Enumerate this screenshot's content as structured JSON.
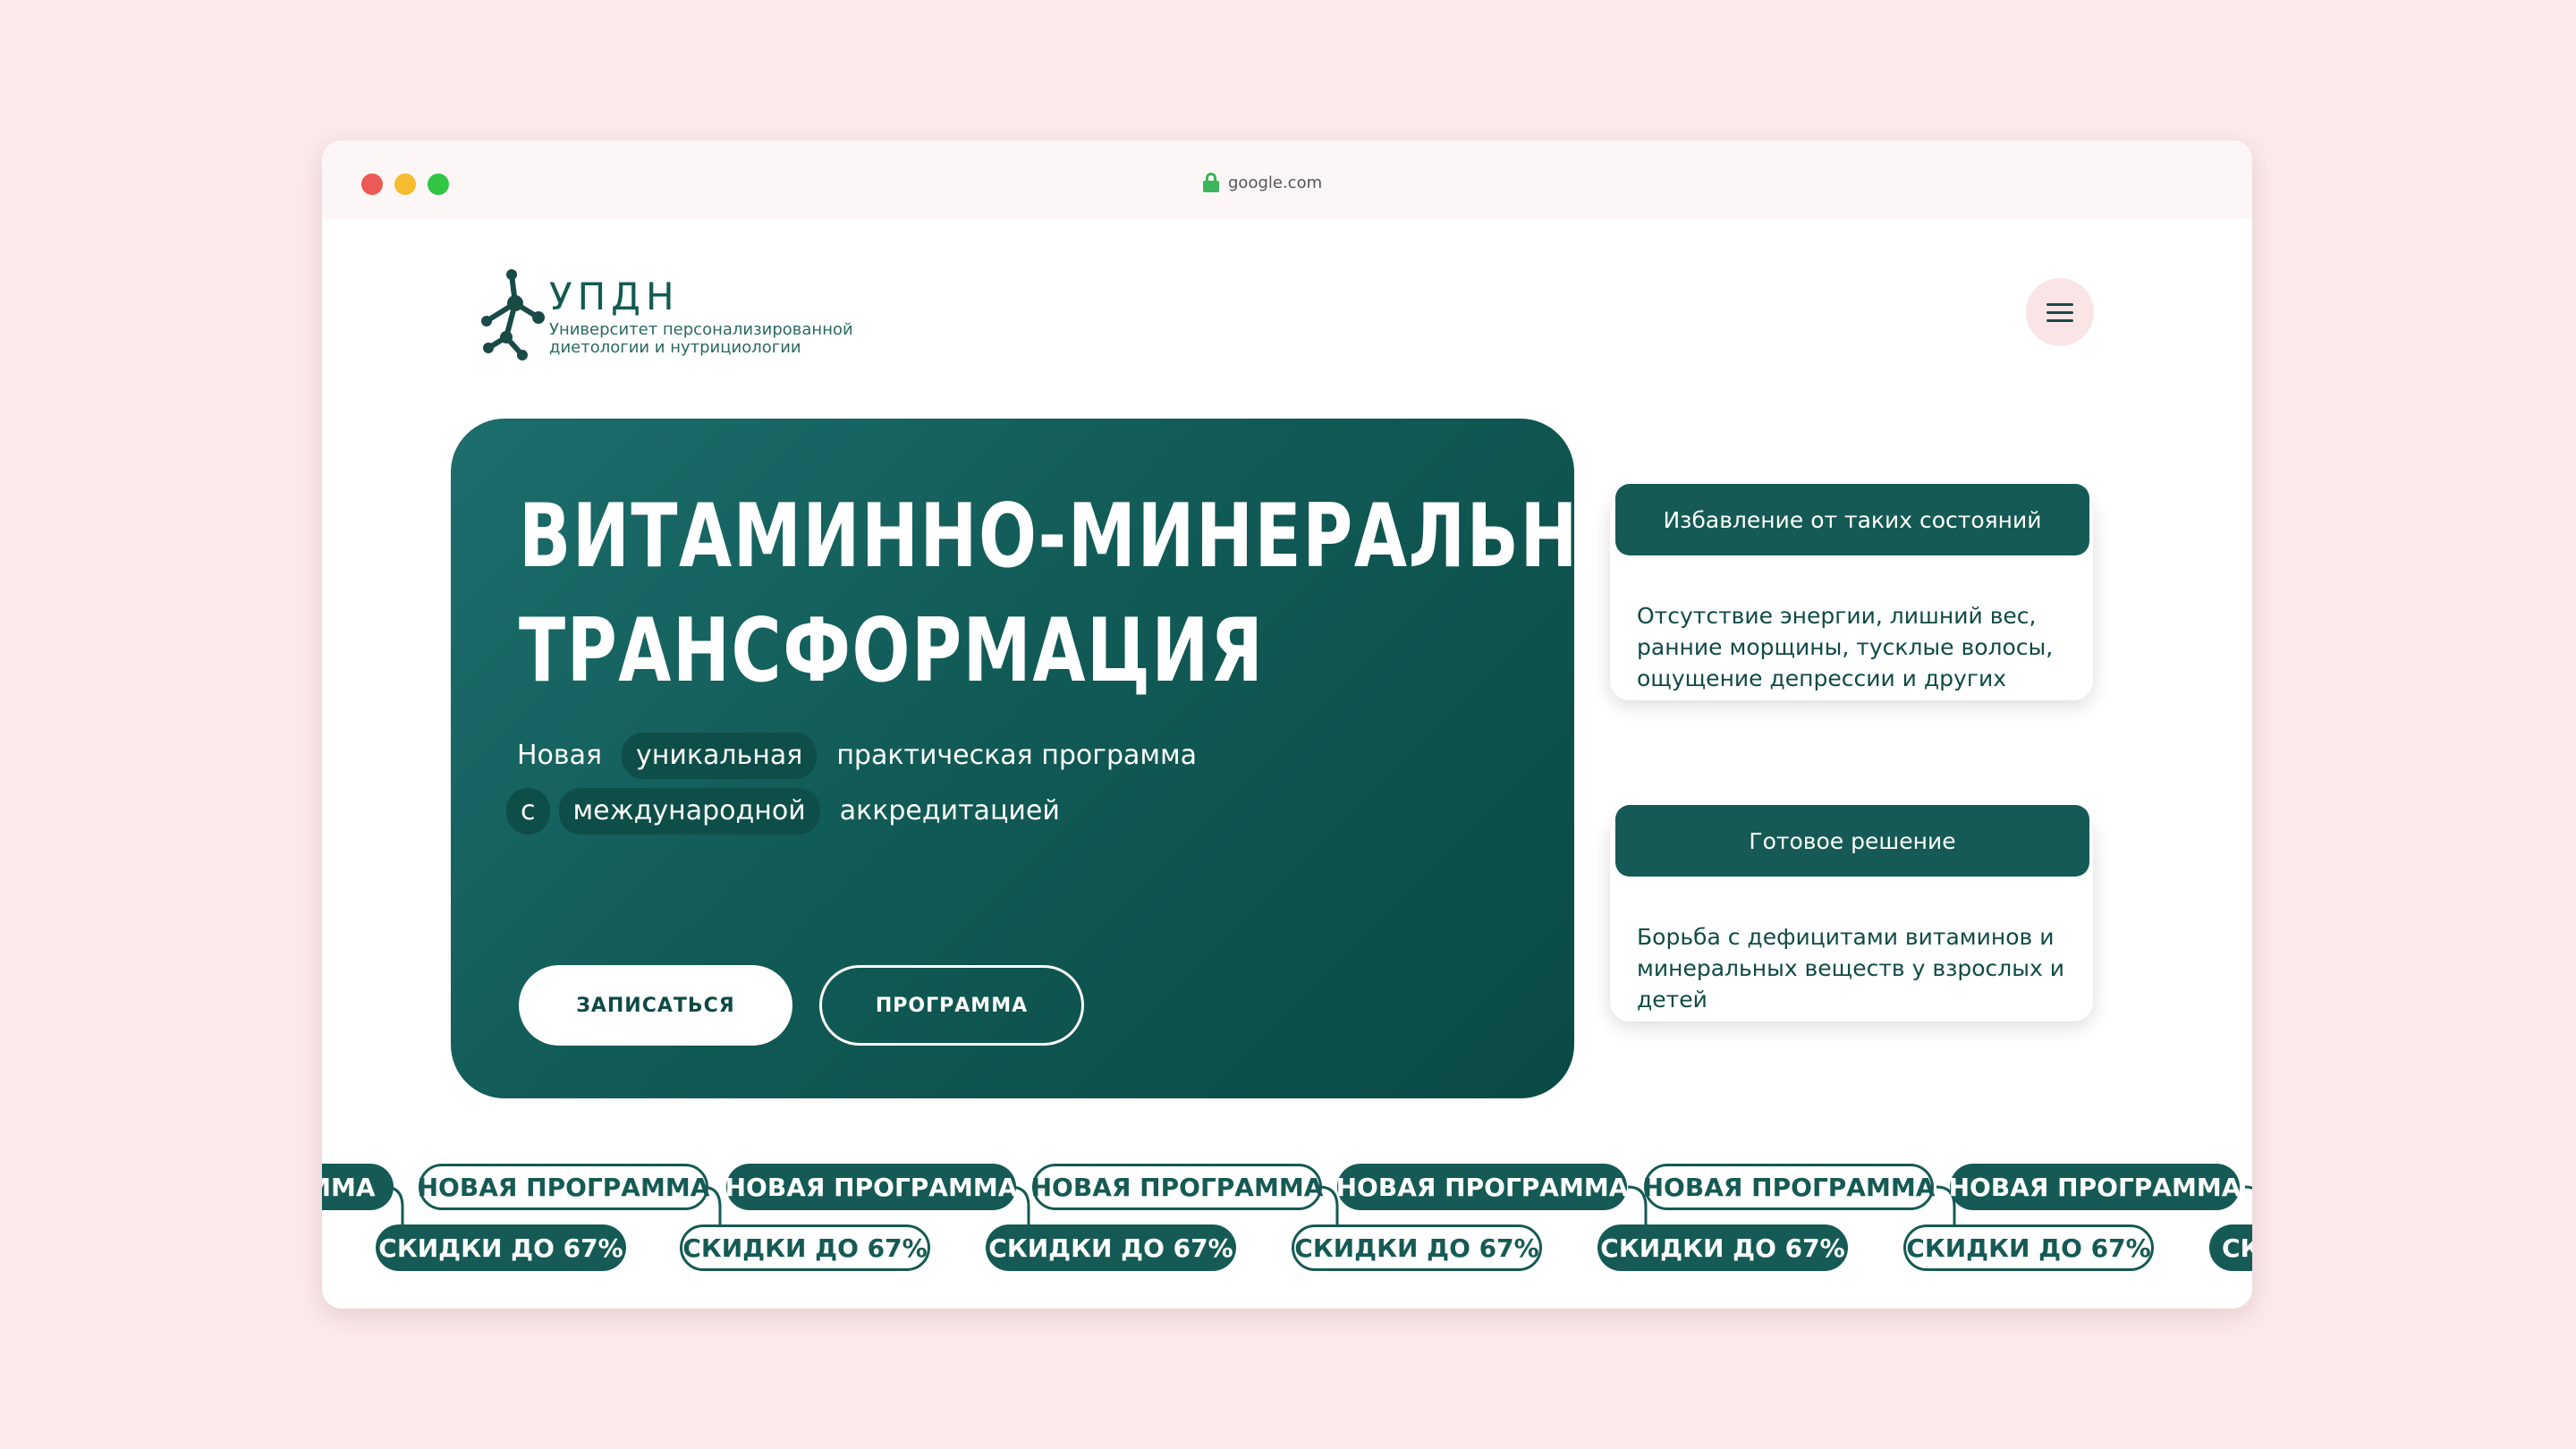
{
  "browser": {
    "url": "google.com"
  },
  "logo": {
    "title": "УПДН",
    "subtitle_line1": "Университет персонализированной",
    "subtitle_line2": "диетологии и нутрициологии"
  },
  "hero": {
    "title_line1": "ВИТАМИННО-МИНЕРАЛЬНАЯ",
    "title_line2": "ТРАНСФОРМАЦИЯ",
    "sub_line1": [
      "Новая",
      "уникальная",
      "практическая программа"
    ],
    "sub_line2": [
      "с",
      "международной",
      "аккредитацией"
    ],
    "primary_button": "ЗАПИСАТЬСЯ",
    "secondary_button": "ПРОГРАММА"
  },
  "cards": [
    {
      "title": "Избавление от таких состояний",
      "body": "Отсутствие энергии, лишний вес, ранние морщины, тусклые волосы, ощущение депрессии и других"
    },
    {
      "title": "Готовое решение",
      "body": "Борьба с дефицитами витаминов и минеральных веществ у взрослых и детей"
    }
  ],
  "ticker": {
    "top_label": "НОВАЯ ПРОГРАММА",
    "top_label_partial": "АММА",
    "bottom_label": "СКИДКИ ДО 67%",
    "bottom_label_partial": "СК"
  },
  "colors": {
    "brand_green": "#155a54",
    "page_background": "#fcebec",
    "menu_background": "#fbe4e6"
  }
}
